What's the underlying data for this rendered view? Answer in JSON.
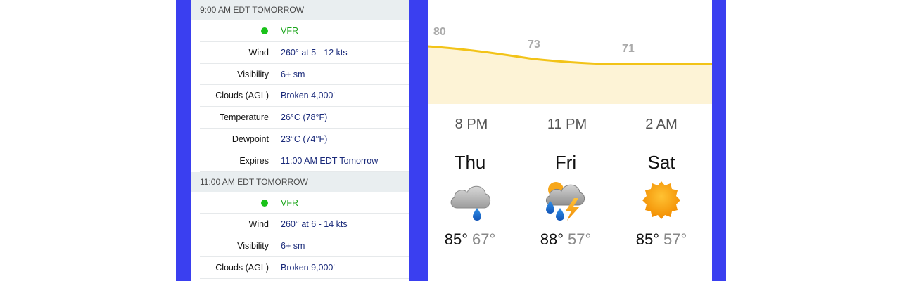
{
  "aviation": {
    "sections": [
      {
        "header": "9:00 AM EDT TOMORROW",
        "category": "VFR",
        "rows": [
          {
            "label": "Wind",
            "value": "260° at 5 - 12 kts"
          },
          {
            "label": "Visibility",
            "value": "6+ sm"
          },
          {
            "label": "Clouds (AGL)",
            "value": "Broken 4,000'"
          },
          {
            "label": "Temperature",
            "value": "26°C (78°F)"
          },
          {
            "label": "Dewpoint",
            "value": "23°C (74°F)"
          },
          {
            "label": "Expires",
            "value": "11:00 AM EDT Tomorrow"
          }
        ]
      },
      {
        "header": "11:00 AM EDT TOMORROW",
        "category": "VFR",
        "rows": [
          {
            "label": "Wind",
            "value": "260° at 6 - 14 kts"
          },
          {
            "label": "Visibility",
            "value": "6+ sm"
          },
          {
            "label": "Clouds (AGL)",
            "value": "Broken 9,000'"
          }
        ]
      }
    ]
  },
  "hourly": {
    "temps": [
      "80",
      "73",
      "71"
    ],
    "times": [
      "8 PM",
      "11 PM",
      "2 AM"
    ]
  },
  "daily": [
    {
      "day": "Thu",
      "high": "85°",
      "low": "67°",
      "icon": "cloud-rain-icon"
    },
    {
      "day": "Fri",
      "high": "88°",
      "low": "57°",
      "icon": "thunderstorm-icon"
    },
    {
      "day": "Sat",
      "high": "85°",
      "low": "57°",
      "icon": "sun-icon"
    }
  ],
  "colors": {
    "frame": "#3a3ff0",
    "vfr": "#1aa51a",
    "value_text": "#1a2a7a",
    "curve": "#f2c318",
    "curve_fill": "#fdf3d6"
  }
}
